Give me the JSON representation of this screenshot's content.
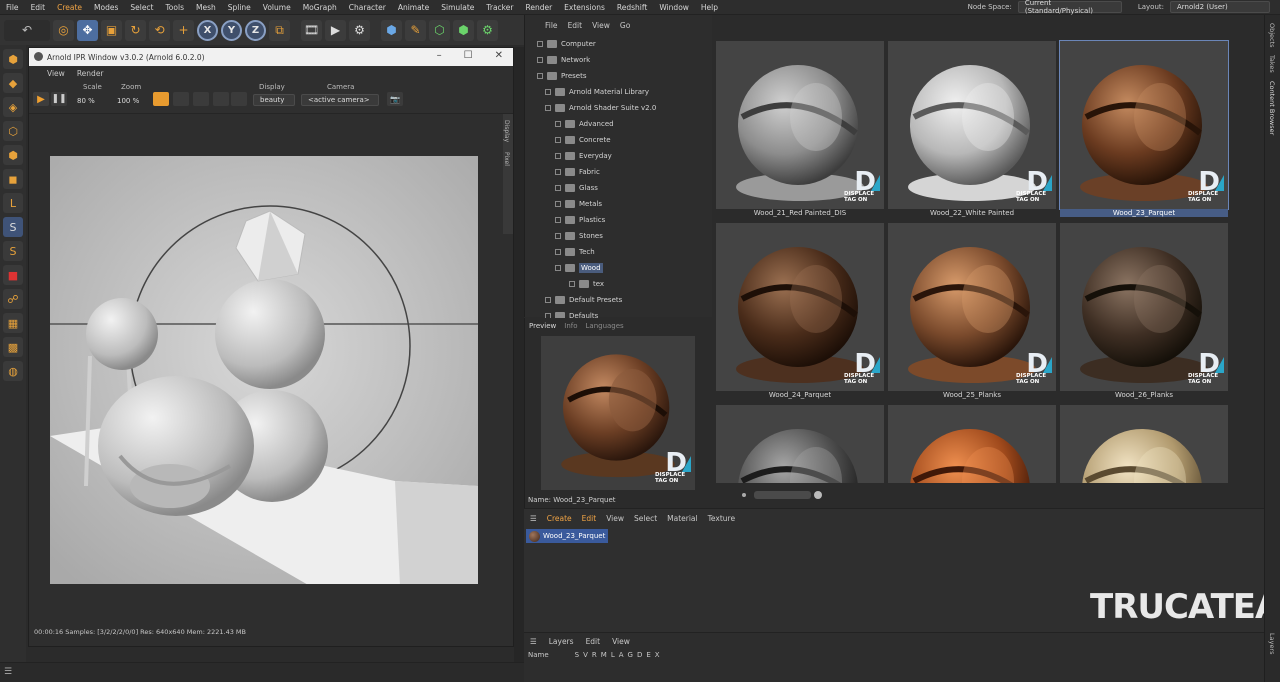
{
  "menubar": {
    "items": [
      "File",
      "Edit",
      "Create",
      "Modes",
      "Select",
      "Tools",
      "Mesh",
      "Spline",
      "Volume",
      "MoGraph",
      "Character",
      "Animate",
      "Simulate",
      "Tracker",
      "Render",
      "Extensions",
      "Redshift",
      "Window",
      "Help"
    ],
    "node_space_label": "Node Space:",
    "node_space_value": "Current (Standard/Physical)",
    "layout_label": "Layout:",
    "layout_value": "Arnold2 (User)"
  },
  "toolbar": {
    "axis_x": "X",
    "axis_y": "Y",
    "axis_z": "Z"
  },
  "ipr": {
    "title": "Arnold IPR Window v3.0.2 (Arnold 6.0.2.0)",
    "menu": [
      "View",
      "Render"
    ],
    "scale_label": "Scale",
    "scale_value": "80 %",
    "zoom_label": "Zoom",
    "zoom_value": "100 %",
    "display_label": "Display",
    "display_value": "beauty",
    "camera_label": "Camera",
    "camera_value": "<active camera>",
    "status": "00:00:16  Samples: [3/2/2/2/0/0]  Res: 640x640  Mem: 2221.43 MB",
    "side_tabs": [
      "Display",
      "Pixel"
    ]
  },
  "content_browser": {
    "menu": [
      "File",
      "Edit",
      "View",
      "Go"
    ],
    "tree": [
      {
        "label": "Computer",
        "level": 0
      },
      {
        "label": "Network",
        "level": 0
      },
      {
        "label": "Presets",
        "level": 0
      },
      {
        "label": "Arnold Material Library",
        "level": 1
      },
      {
        "label": "Arnold Shader Suite v2.0",
        "level": 1
      },
      {
        "label": "Advanced",
        "level": 2
      },
      {
        "label": "Concrete",
        "level": 2
      },
      {
        "label": "Everyday",
        "level": 2
      },
      {
        "label": "Fabric",
        "level": 2
      },
      {
        "label": "Glass",
        "level": 2
      },
      {
        "label": "Metals",
        "level": 2
      },
      {
        "label": "Plastics",
        "level": 2
      },
      {
        "label": "Stones",
        "level": 2
      },
      {
        "label": "Tech",
        "level": 2
      },
      {
        "label": "Wood",
        "level": 2,
        "selected": true
      },
      {
        "label": "tex",
        "level": 3
      },
      {
        "label": "Default Presets",
        "level": 1
      },
      {
        "label": "Defaults",
        "level": 1
      }
    ]
  },
  "preview": {
    "tabs": [
      "Preview",
      "Info",
      "Languages"
    ],
    "name": "Name: Wood_23_Parquet"
  },
  "grid": {
    "tiles": [
      {
        "label": "Wood_21_Red Painted_DIS",
        "tone": "gray"
      },
      {
        "label": "Wood_22_White Painted",
        "tone": "white"
      },
      {
        "label": "Wood_23_Parquet",
        "tone": "parquet",
        "selected": true
      },
      {
        "label": "Wood_24_Parquet",
        "tone": "dark"
      },
      {
        "label": "Wood_25_Planks",
        "tone": "planks"
      },
      {
        "label": "Wood_26_Planks",
        "tone": "darkplanks"
      },
      {
        "label": "",
        "tone": "stripes"
      },
      {
        "label": "",
        "tone": "orange"
      },
      {
        "label": "",
        "tone": "light"
      }
    ],
    "badge_letter": "D",
    "badge_text_1": "DISPLACE",
    "badge_text_2": "TAG ON"
  },
  "material_manager": {
    "menu": [
      "Create",
      "Edit",
      "View",
      "Select",
      "Material",
      "Texture"
    ],
    "material": "Wood_23_Parquet",
    "watermark": "TRUCATEAM."
  },
  "layers": {
    "menu": [
      "Layers",
      "Edit",
      "View"
    ],
    "name_col": "Name",
    "flags": [
      "S",
      "V",
      "R",
      "M",
      "L",
      "A",
      "G",
      "D",
      "E",
      "X"
    ]
  },
  "right_strip": {
    "tabs": [
      "Objects",
      "Takes",
      "Content Browser",
      "Layers"
    ]
  }
}
